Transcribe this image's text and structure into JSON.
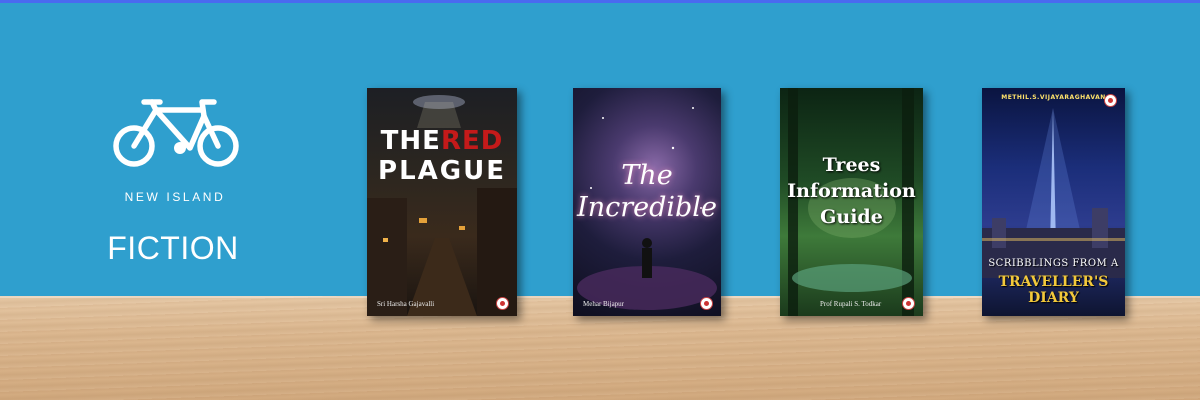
{
  "brand": {
    "imprint": "NEW ISLAND",
    "genre": "FICTION",
    "logo_icon": "bicycle-icon"
  },
  "books": [
    {
      "title_part1": "THE",
      "title_part2": "RED",
      "title_part3": "PLAGUE",
      "author": "Sri Harsha Gajavalli"
    },
    {
      "title_line1": "The",
      "title_line2": "Incredible",
      "author": "Mehar Bijapur"
    },
    {
      "title_line1": "Trees",
      "title_line2": "Information",
      "title_line3": "Guide",
      "author": "Prof Rupali S. Todkar"
    },
    {
      "author": "METHIL.S.VIJAYARAGHAVAN",
      "title_line1": "SCRIBBLINGS FROM A",
      "title_line2": "TRAVELLER'S",
      "title_line3": "DIARY"
    }
  ],
  "colors": {
    "wall": "#2f9fce",
    "shelf": "#dcb890",
    "accent_red": "#c41a1a",
    "accent_gold": "#f3c93b"
  }
}
